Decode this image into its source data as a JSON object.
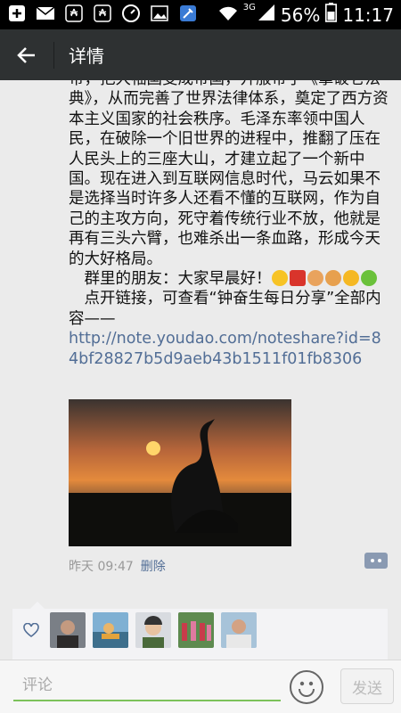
{
  "status_bar": {
    "network": "3G",
    "battery": "56%",
    "time": "11:17"
  },
  "header": {
    "title": "详情"
  },
  "post": {
    "text_main": "带，把大袖国变成帝国，开服帝子《拿破仑法典》，从而完善了世界法律体系，奠定了西方资本主义国家的社会秩序。毛泽东率领中国人民，在破除一个旧世界的进程中，推翻了压在人民头上的三座大山，才建立起了一个新中国。现在进入到互联网信息时代，马云如果不是选择当时许多人还看不懂的互联网，作为自己的主攻方向，死守着传统行业不放，他就是再有三头六臂，也难杀出一条血路，形成今天的大好格局。",
    "greeting": "　群里的朋友：大家早晨好！",
    "link_prompt": "　点开链接，可查看“钟奋生每日分享”全部内容——",
    "link_url": "http://note.youdao.com/noteshare?id=84bf28827b5d9aeb43b1511f01fb8306",
    "time": "昨天 09:47",
    "delete_label": "删除"
  },
  "comment_bar": {
    "placeholder": "评论",
    "send_label": "发送"
  },
  "colors": {
    "titlebar": "#2e3132",
    "link": "#526e96",
    "input_underline": "#7cc25a"
  },
  "icons": [
    "plus-icon",
    "mail-icon",
    "huawei-icon",
    "huawei-icon",
    "gauge-icon",
    "image-icon",
    "brush-icon",
    "wifi-icon",
    "signal-icon",
    "battery-icon",
    "back-arrow-icon",
    "heart-icon",
    "emoji-icon",
    "more-icon"
  ]
}
